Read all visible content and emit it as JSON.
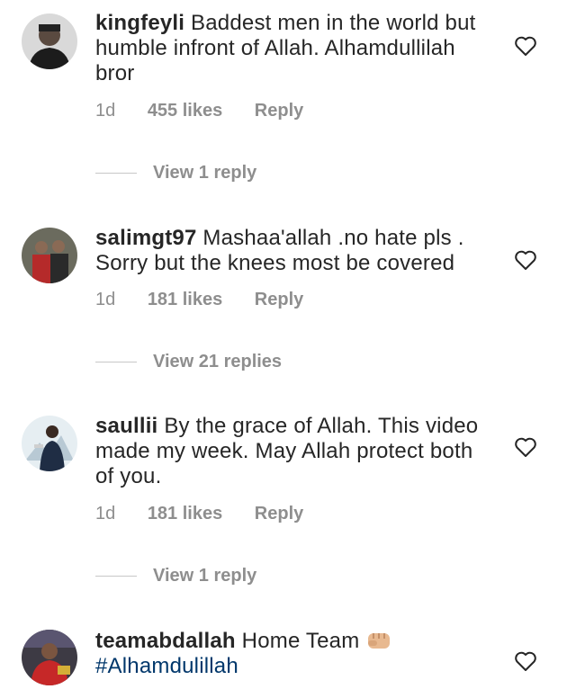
{
  "comments": [
    {
      "username": "kingfeyli",
      "text": "Baddest men in the world but humble infront of Allah. Alhamdullilah bror",
      "time": "1d",
      "likes": "455 likes",
      "reply": "Reply",
      "view_replies": "View 1 reply"
    },
    {
      "username": "salimgt97",
      "text": "Mashaa'allah .no hate pls . Sorry but the knees most be covered",
      "time": "1d",
      "likes": "181 likes",
      "reply": "Reply",
      "view_replies": "View 21 replies"
    },
    {
      "username": "saullii",
      "text": "By the grace of Allah. This video made my week. May Allah protect both of you.",
      "time": "1d",
      "likes": "181 likes",
      "reply": "Reply",
      "view_replies": "View 1 reply"
    },
    {
      "username": "teamabdallah",
      "text": "Home Team",
      "emoji": "fist-emoji",
      "hashtag": "#Alhamdulillah"
    }
  ],
  "colors": {
    "text": "#262626",
    "muted": "#8e8e8e",
    "hashtag": "#00376b",
    "divider": "#c7c7c7"
  },
  "icons": {
    "like": "heart-outline-icon"
  }
}
